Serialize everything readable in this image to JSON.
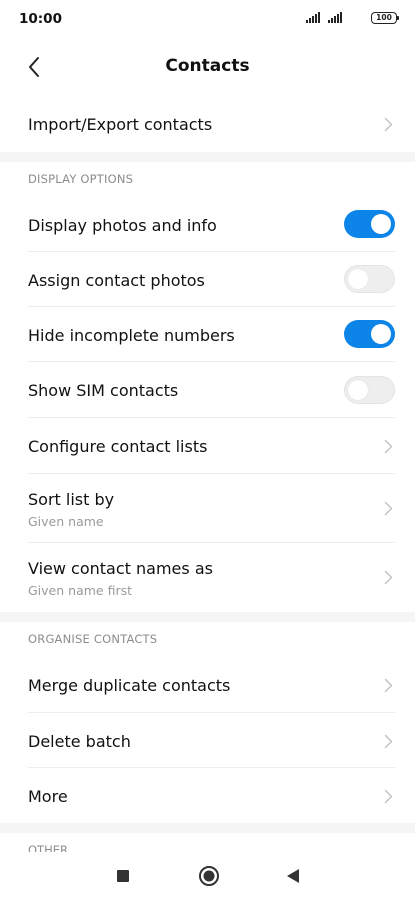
{
  "status_bar": {
    "time": "10:00",
    "battery": "100"
  },
  "header": {
    "title": "Contacts"
  },
  "import_export": {
    "label": "Import/Export contacts"
  },
  "display_options": {
    "section_label": "DISPLAY OPTIONS",
    "display_photos": {
      "label": "Display photos and info",
      "enabled": true
    },
    "assign_photos": {
      "label": "Assign contact photos",
      "enabled": false
    },
    "hide_incomplete": {
      "label": "Hide incomplete numbers",
      "enabled": true
    },
    "show_sim": {
      "label": "Show SIM contacts",
      "enabled": false
    },
    "configure_lists": {
      "label": "Configure contact lists"
    },
    "sort_list": {
      "label": "Sort list by",
      "value": "Given name"
    },
    "view_names": {
      "label": "View contact names as",
      "value": "Given name first"
    }
  },
  "organise_contacts": {
    "section_label": "ORGANISE CONTACTS",
    "merge": {
      "label": "Merge duplicate contacts"
    },
    "delete_batch": {
      "label": "Delete batch"
    },
    "more": {
      "label": "More"
    }
  },
  "other": {
    "section_label": "OTHER"
  },
  "colors": {
    "accent": "#0d84e7",
    "toggle_off": "#eeeeee",
    "section_bg": "#f5f5f5",
    "secondary_text": "#9a9a9a"
  },
  "icons": {
    "back": "chevron-left-icon",
    "row_arrow": "chevron-right-icon",
    "recents": "square-icon",
    "home": "circle-icon",
    "back_nav": "triangle-icon"
  }
}
